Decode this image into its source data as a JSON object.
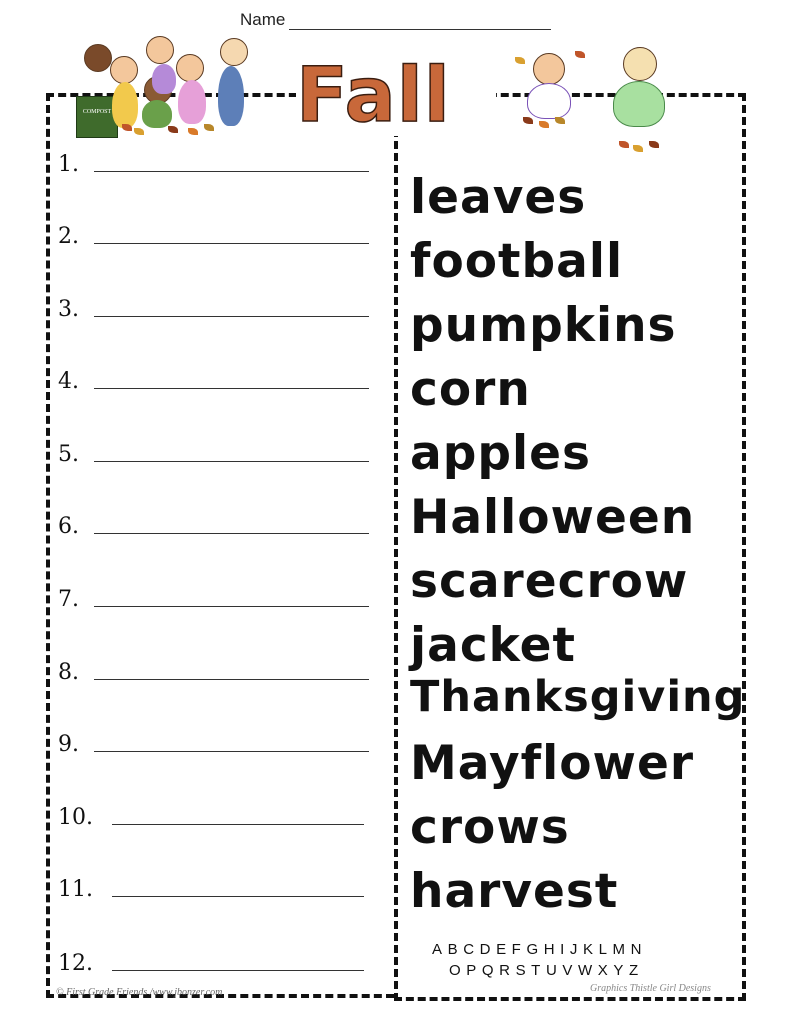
{
  "header": {
    "name_label": "Name",
    "title": "Fall"
  },
  "answers": [
    {
      "number": "1."
    },
    {
      "number": "2."
    },
    {
      "number": "3."
    },
    {
      "number": "4."
    },
    {
      "number": "5."
    },
    {
      "number": "6."
    },
    {
      "number": "7."
    },
    {
      "number": "8."
    },
    {
      "number": "9."
    },
    {
      "number": "10."
    },
    {
      "number": "11."
    },
    {
      "number": "12."
    }
  ],
  "word_bank": [
    "leaves",
    "football",
    "pumpkins",
    "corn",
    "apples",
    "Halloween",
    "scarecrow",
    "jacket",
    "Thanksgiving",
    "Mayflower",
    "crows",
    "harvest"
  ],
  "alphabet": {
    "row1": "ABCDEFGHIJKLMN",
    "row2": "OPQRSTUVWXYZ"
  },
  "clipart": {
    "left_bin_label": "COMPOST"
  },
  "credits": {
    "left": "© First Grade Friends /www.jbonzer.com",
    "right": "Graphics Thistle Girl Designs"
  },
  "colors": {
    "title_fill": "#c8683a",
    "border": "#111111"
  }
}
